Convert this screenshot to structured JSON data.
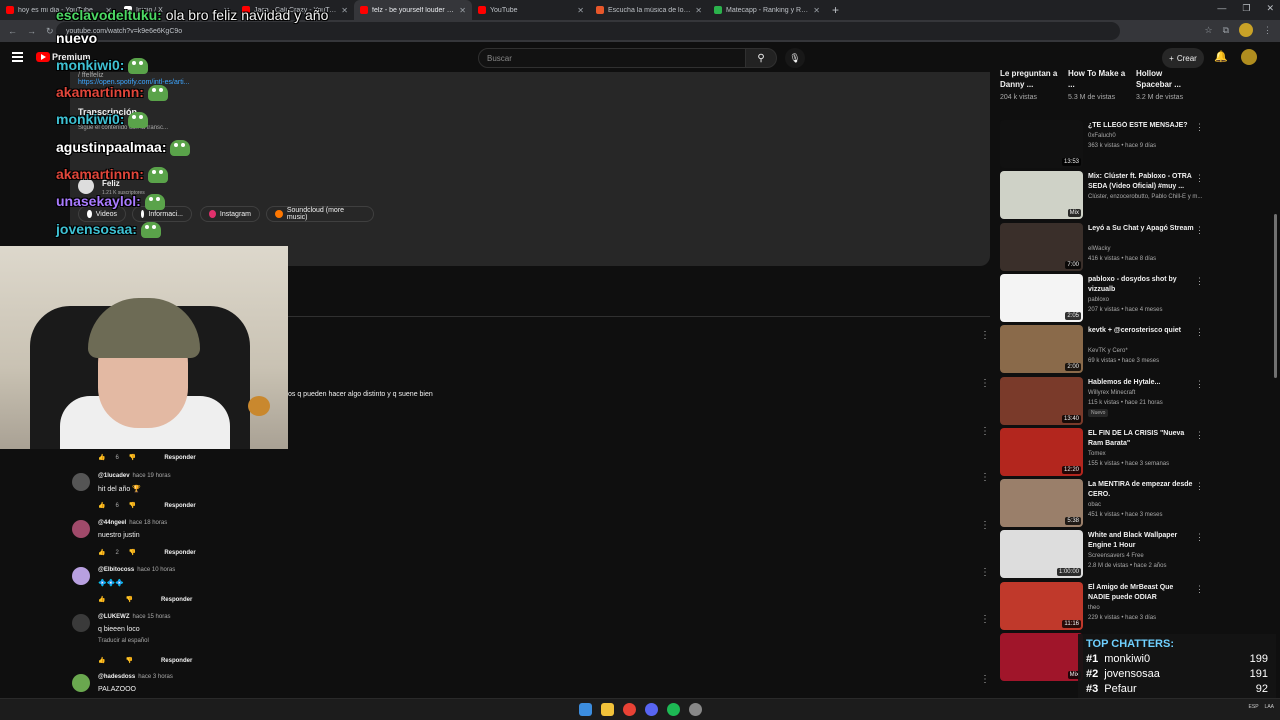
{
  "browser": {
    "tabs": [
      {
        "title": "hoy es mi dia - YouTube",
        "color": "#ff0000",
        "active": false
      },
      {
        "title": "Inicio / X",
        "color": "#ffffff",
        "active": false
      },
      {
        "title": "Jaca - Cali Crazy - YouTube",
        "color": "#ff0000",
        "active": false
      },
      {
        "title": "felz - be yourself louder (video",
        "color": "#ff0000",
        "active": true
      },
      {
        "title": "YouTube",
        "color": "#ff0000",
        "active": false
      },
      {
        "title": "Escucha la música de lolowtf |",
        "color": "#e8572a",
        "active": false
      },
      {
        "title": "Matecapp - Ranking y Racha d",
        "color": "#2bb24c",
        "active": false
      }
    ],
    "url": "youtube.com/watch?v=k9e6e6KgC9o"
  },
  "youtube_header": {
    "premium_label": "Premium",
    "search_placeholder": "Buscar",
    "create_label": "Crear"
  },
  "description": {
    "spotify_link": "https://open.spotify.com/intl-es/arti...",
    "link_prefix": "/ ffelfeliz",
    "transcript_title": "Transcripción",
    "transcript_sub": "Sigue el contenido con la transc...",
    "channel_name": "Feliz",
    "channel_subs": "1.21 K suscriptores",
    "links": [
      {
        "label": "Videos",
        "color": "#ffffff"
      },
      {
        "label": "Informaci...",
        "color": "#ffffff"
      },
      {
        "label": "Instagram",
        "color": "#e1306c"
      },
      {
        "label": "Soundcloud (more music)",
        "color": "#ff7700"
      }
    ]
  },
  "comment_fragment": "os q pueden hacer algo distinto y q suene bien",
  "comments": [
    {
      "user": "@1lucadev",
      "time": "hace 19 horas",
      "text": "hit del año 🏆",
      "likes": "6",
      "reply": "Responder",
      "avatar_color": "#555555"
    },
    {
      "user": "@44ngeel",
      "time": "hace 18 horas",
      "text": "nuestro justin",
      "likes": "2",
      "reply": "Responder",
      "avatar_color": "#a04a6a"
    },
    {
      "user": "@Elbitocoss",
      "time": "hace 10 horas",
      "text": "💠💠💠",
      "likes": "",
      "reply": "Responder",
      "avatar_color": "#b8a0e0"
    },
    {
      "user": "@LUKEWZ",
      "time": "hace 15 horas",
      "text": "q bieeen loco",
      "translate": "Traducir al español",
      "likes": "",
      "reply": "Responder",
      "avatar_color": "#3a3a3a"
    },
    {
      "user": "@hadesdoss",
      "time": "hace 3 horas",
      "text": "PALAZOOO",
      "avatar_color": "#6aa84f"
    }
  ],
  "first_actions": {
    "likes": "6",
    "reply": "Responder"
  },
  "top_row": [
    {
      "title": "Le preguntan a Danny ...",
      "views": "204 k vistas"
    },
    {
      "title": "How To Make a ...",
      "views": "5.3 M de vistas"
    },
    {
      "title": "Hollow Spacebar ...",
      "views": "3.2 M de vistas"
    }
  ],
  "sidebar": [
    {
      "title": "¿TE LLEGÓ ESTE MENSAJE?",
      "channel": "0xFaluch0",
      "meta": "363 k vistas • hace 9 días",
      "duration": "13:53",
      "thumb": "#111111"
    },
    {
      "title": "Mix: Clúster ft. Pabloxo - OTRA SEDA (Video Oficial) #muy ...",
      "channel": "Clúster, enzocerobutto, Pablo Chill-E y m...",
      "meta": "",
      "duration": "Mix",
      "thumb": "#cfd2c7"
    },
    {
      "title": "Leyó a Su Chat y Apagó Stream",
      "channel": "elWacky",
      "meta": "416 k vistas • hace 8 días",
      "duration": "7:00",
      "thumb": "#3a2f2a"
    },
    {
      "title": "pabloxo - dosydos shot by vizzualb",
      "channel": "pabloxo",
      "meta": "207 k vistas • hace 4 meses",
      "duration": "2:05",
      "thumb": "#f4f4f4"
    },
    {
      "title": "kevtk + @cerosterisco quiet",
      "channel": "KevTK y Cero*",
      "meta": "69 k vistas • hace 3 meses",
      "duration": "2:00",
      "thumb": "#8a6a4a"
    },
    {
      "title": "Hablemos de Hytale...",
      "channel": "Willyrex Minecraft",
      "meta": "115 k vistas • hace 21 horas",
      "badge": "Nuevo",
      "duration": "13:40",
      "thumb": "#7a3a2a"
    },
    {
      "title": "EL FIN DE LA CRISIS \"Nueva Ram Barata\"",
      "channel": "Tomex",
      "meta": "155 k vistas • hace 3 semanas",
      "duration": "12:20",
      "thumb": "#b3261e"
    },
    {
      "title": "La MENTIRA de empezar desde CERO.",
      "channel": "obac",
      "meta": "451 k vistas • hace 3 meses",
      "duration": "5:38",
      "thumb": "#9a7f6a"
    },
    {
      "title": "White and Black Wallpaper Engine 1 Hour",
      "channel": "Screensavers 4 Free",
      "meta": "2.8 M de vistas • hace 2 años",
      "duration": "1:00:00",
      "thumb": "#dddddd"
    },
    {
      "title": "El Amigo de MrBeast Que NADIE puede ODIAR",
      "channel": "theo",
      "meta": "229 k vistas • hace 3 días",
      "duration": "11:16",
      "thumb": "#c0392b"
    },
    {
      "title": "",
      "channel": "",
      "meta": "",
      "duration": "Mix",
      "thumb": "#a0152a"
    }
  ],
  "stream_chat": [
    {
      "user": "esclavodeltuku:",
      "msg": "ola bro feliz navidad y año",
      "color": "#4cd964",
      "emote": false
    },
    {
      "user": "nuevo",
      "msg": "",
      "color": "#ffffff",
      "emote": false
    },
    {
      "user": "monkiwi0:",
      "msg": "",
      "color": "#3ec1d3",
      "emote": true
    },
    {
      "user": "akamartinnn:",
      "msg": "",
      "color": "#e0463a",
      "emote": true
    },
    {
      "user": "monkiwi0:",
      "msg": "",
      "color": "#3ec1d3",
      "emote": true
    },
    {
      "user": "agustinpaalmaa:",
      "msg": "",
      "color": "#ffffff",
      "emote": true
    },
    {
      "user": "akamartinnn:",
      "msg": "",
      "color": "#e0463a",
      "emote": true
    },
    {
      "user": "unasekaylol:",
      "msg": "",
      "color": "#a97bff",
      "emote": true
    },
    {
      "user": "jovensosaa:",
      "msg": "",
      "color": "#3ec1d3",
      "emote": true
    }
  ],
  "top_chatters": {
    "title": "TOP CHATTERS:",
    "rows": [
      {
        "rank": "#1",
        "name": "monkiwi0",
        "count": "199"
      },
      {
        "rank": "#2",
        "name": "jovensosaa",
        "count": "191"
      },
      {
        "rank": "#3",
        "name": "Pefaur",
        "count": "92"
      }
    ]
  },
  "taskbar": {
    "icons": [
      {
        "name": "windows-start-icon",
        "color": "#3c8dde"
      },
      {
        "name": "file-explorer-icon",
        "color": "#f2c23a"
      },
      {
        "name": "chrome-icon",
        "color": "#e94235"
      },
      {
        "name": "discord-icon",
        "color": "#5865f2"
      },
      {
        "name": "spotify-icon",
        "color": "#1db954"
      },
      {
        "name": "obs-icon",
        "color": "#888888"
      }
    ],
    "lang": "ESP",
    "lang2": "LAA"
  }
}
